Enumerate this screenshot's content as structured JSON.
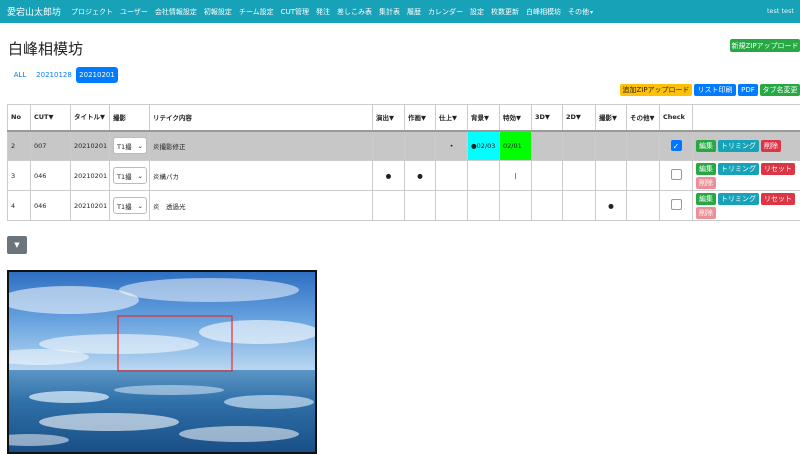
{
  "nav": {
    "brand": "愛宕山太郎坊",
    "items": [
      "プロジェクト",
      "ユーザー",
      "会社情報設定",
      "初報設定",
      "チーム設定",
      "CUT管理",
      "発注",
      "差しこみ表",
      "集計表",
      "履歴",
      "カレンダー",
      "設定",
      "枚数更新",
      "白峰相模坊",
      "その他"
    ],
    "user": "test  test"
  },
  "page": {
    "title": "白峰相模坊"
  },
  "buttons": {
    "new_zip": "新規ZIPアップロード",
    "add_zip": "追加ZIPアップロード",
    "list_print": "リスト印刷",
    "pdf": "PDF",
    "tab_rename": "タブ名変更"
  },
  "tabs": [
    "ALL",
    "20210128",
    "20210201"
  ],
  "table": {
    "headers": [
      "No",
      "CUT▼",
      "タイトル▼",
      "撮影",
      "リテイク内容",
      "演出▼",
      "作画▼",
      "仕上▼",
      "背景▼",
      "特効▼",
      "3D▼",
      "2D▼",
      "撮影▼",
      "その他▼",
      "Check",
      ""
    ],
    "rows": [
      {
        "no": "2",
        "cut": "007",
        "title": "20210201",
        "select": "T1撮",
        "content": "炎撮影修正",
        "bg": "●02/03",
        "fx": "02/01",
        "checked": true
      },
      {
        "no": "3",
        "cut": "046",
        "title": "20210201",
        "select": "T1撮",
        "content": "炎構パカ",
        "direction": "●",
        "anim": "●",
        "fx": "|",
        "checked": false
      },
      {
        "no": "4",
        "cut": "046",
        "title": "20210201",
        "select": "T1撮",
        "content": "炎　透過光",
        "photo": "●",
        "checked": false
      }
    ],
    "action_labels": {
      "edit": "編集",
      "trim": "トリミング",
      "delete": "削除",
      "reset": "リセット"
    }
  },
  "toggle": "▼",
  "colors": {
    "navbar": "#17a2b8",
    "success": "#28a745",
    "warning": "#ffc107",
    "primary": "#007bff",
    "danger": "#dc3545",
    "cyan": "#00ffff",
    "green": "#00ff00"
  }
}
